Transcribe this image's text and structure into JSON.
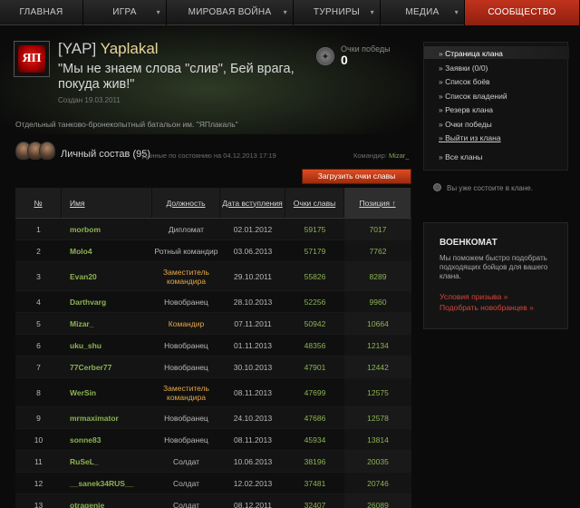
{
  "nav": {
    "items": [
      {
        "label": "ГЛАВНАЯ",
        "arrow": ""
      },
      {
        "label": "ИГРА",
        "arrow": "▾"
      },
      {
        "label": "МИРОВАЯ ВОЙНА",
        "arrow": "▾"
      },
      {
        "label": "ТУРНИРЫ",
        "arrow": "▾"
      },
      {
        "label": "МЕДИА",
        "arrow": "▾"
      },
      {
        "label": "СООБЩЕСТВО",
        "arrow": ""
      }
    ]
  },
  "clan": {
    "tag": "[YAP]",
    "name": "Yaplakal",
    "emblem_text": "ЯП",
    "motto": "\"Мы не знаем слова \"слив\", Бей врага, покуда жив!\"",
    "created": "Создан 19.03.2011",
    "description": "Отдельный танково-бронекопытный батальон им. \"ЯПлакаль\"",
    "victory_label": "Очки победы",
    "victory_value": "0"
  },
  "roster": {
    "title": "Личный состав (95)",
    "date": "Данные по состоянию на 04.12.2013 17:19",
    "commander_label": "Командир:",
    "commander_name": "Mizar_",
    "load_button": "Загрузить очки славы"
  },
  "table": {
    "headers": {
      "num": "№",
      "name": "Имя",
      "role": "Должность",
      "joined": "Дата вступления",
      "glory": "Очки славы",
      "position": "Позиция ↑"
    },
    "rows": [
      {
        "num": "1",
        "name": "morbom",
        "role": "Дипломат",
        "joined": "02.01.2012",
        "glory": "59175",
        "position": "7017"
      },
      {
        "num": "2",
        "name": "Molo4",
        "role": "Ротный командир",
        "joined": "03.06.2013",
        "glory": "57179",
        "position": "7762"
      },
      {
        "num": "3",
        "name": "Evan20",
        "role": "Заместитель командира",
        "joined": "29.10.2011",
        "glory": "55826",
        "position": "8289"
      },
      {
        "num": "4",
        "name": "Darthvarg",
        "role": "Новобранец",
        "joined": "28.10.2013",
        "glory": "52256",
        "position": "9960"
      },
      {
        "num": "5",
        "name": "Mizar_",
        "role": "Командир",
        "joined": "07.11.2011",
        "glory": "50942",
        "position": "10664"
      },
      {
        "num": "6",
        "name": "uku_shu",
        "role": "Новобранец",
        "joined": "01.11.2013",
        "glory": "48356",
        "position": "12134"
      },
      {
        "num": "7",
        "name": "77Cerber77",
        "role": "Новобранец",
        "joined": "30.10.2013",
        "glory": "47901",
        "position": "12442"
      },
      {
        "num": "8",
        "name": "WerSin",
        "role": "Заместитель командира",
        "joined": "08.11.2013",
        "glory": "47699",
        "position": "12575"
      },
      {
        "num": "9",
        "name": "mrmaximator",
        "role": "Новобранец",
        "joined": "24.10.2013",
        "glory": "47686",
        "position": "12578"
      },
      {
        "num": "10",
        "name": "sonne83",
        "role": "Новобранец",
        "joined": "08.11.2013",
        "glory": "45934",
        "position": "13814"
      },
      {
        "num": "11",
        "name": "RuSeL_",
        "role": "Солдат",
        "joined": "10.06.2013",
        "glory": "38196",
        "position": "20035"
      },
      {
        "num": "12",
        "name": "__sanek34RUS__",
        "role": "Солдат",
        "joined": "12.02.2013",
        "glory": "37481",
        "position": "20746"
      },
      {
        "num": "13",
        "name": "otragenie",
        "role": "Солдат",
        "joined": "08.12.2011",
        "glory": "32407",
        "position": "26089"
      }
    ]
  },
  "sidebar": {
    "items": [
      "Страница клана",
      "Заявки (0/0)",
      "Список боёв",
      "Список владений",
      "Резерв клана",
      "Очки победы",
      "Выйти из клана",
      "Все кланы"
    ],
    "note": "Вы уже состоите в клане."
  },
  "recruit": {
    "title": "ВОЕНКОМАТ",
    "text": "Мы поможем быстро подобрать подходящих бойцов для вашего клана.",
    "link1": "Условия призыва »",
    "link2": "Подобрать новобранцев »"
  }
}
